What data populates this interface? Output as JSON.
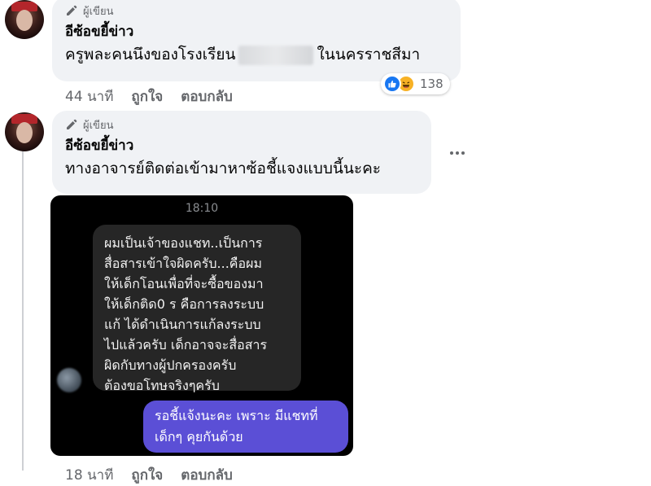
{
  "comments": [
    {
      "author_badge": "ผู้เขียน",
      "author_name": "อีซ้อขยี้ข่าว",
      "text_before": "ครูพละคนนึงของโรงเรียน",
      "text_after": "ในนครราชสีมา",
      "time": "44 นาที",
      "like_label": "ถูกใจ",
      "reply_label": "ตอบกลับ",
      "reaction_icons": [
        "like-icon",
        "haha-icon"
      ],
      "reaction_count": "138"
    },
    {
      "author_badge": "ผู้เขียน",
      "author_name": "อีซ้อขยี้ข่าว",
      "text": "ทางอาจารย์ติดต่อเข้ามาหาซ้อชี้แจงแบบนี้นะคะ",
      "time": "18 นาที",
      "like_label": "ถูกใจ",
      "reply_label": "ตอบกลับ",
      "attachment": {
        "chat_time": "18:10",
        "incoming_lines": [
          "ผมเป็นเจ้าของแชท..เป็นการ",
          "สื่อสารเข้าใจผิดครับ...คือผม",
          "ให้เด็กโอนเพื่อที่จะซื้อของมา",
          "ให้เด็กติด0 ร คือการลงระบบ",
          "แก้ ได้ดำเนินการแก้ลงระบบ",
          "ไปแล้วครับ เด็กอาจจะสื่อสาร",
          "ผิดกับทางผู้ปกครองครับ",
          "ต้องขอโทษจริงๆครับ"
        ],
        "outgoing_lines": [
          "รอชี้แจ้งนะคะ เพราะ มีแชทที่",
          "เด็กๆ คุยกันด้วย"
        ]
      }
    }
  ],
  "icons": {
    "author_badge_icon": "pencil-icon",
    "more_icon": "more-options-icon"
  },
  "colors": {
    "bubble_bg": "#f0f2f5",
    "meta_text": "#65676b",
    "like_blue": "#1877f2",
    "haha_yellow": "#f7b125",
    "outgoing_purple": "#5b4fd6"
  }
}
